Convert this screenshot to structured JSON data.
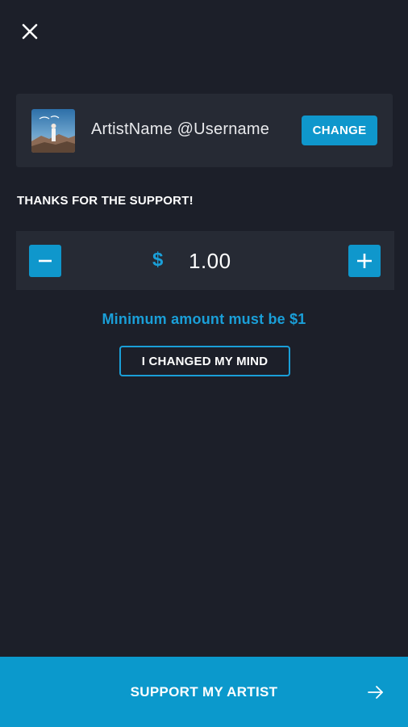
{
  "icons": {
    "close": "close-icon",
    "minus": "minus-icon",
    "plus": "plus-icon",
    "arrow": "arrow-right-icon"
  },
  "artist": {
    "name_label": "ArtistName @Username",
    "change_label": "CHANGE"
  },
  "support": {
    "thanks_text": "THANKS FOR THE SUPPORT!",
    "currency_symbol": "$",
    "amount": "1.00",
    "min_message": "Minimum amount must be $1",
    "changed_mind_label": "I CHANGED MY MIND",
    "cta_label": "SUPPORT MY ARTIST"
  },
  "colors": {
    "background": "#1c1f29",
    "card": "#262a34",
    "accent": "#0f97cc",
    "accent_text": "#1a9fd8"
  }
}
